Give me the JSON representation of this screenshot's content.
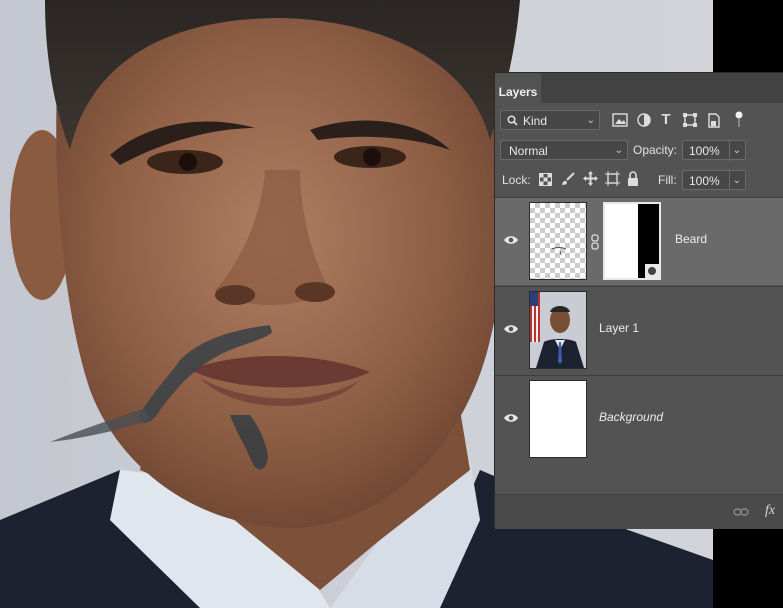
{
  "panel": {
    "tab_label": "Layers",
    "filter": {
      "selected": "Kind"
    },
    "blend": {
      "mode": "Normal",
      "opacity_label": "Opacity:",
      "opacity_value": "100%"
    },
    "lock": {
      "label": "Lock:",
      "fill_label": "Fill:",
      "fill_value": "100%"
    },
    "layers": [
      {
        "name": "Beard",
        "selected": true,
        "visible": true
      },
      {
        "name": "Layer 1",
        "selected": false,
        "visible": true
      },
      {
        "name": "Background",
        "selected": false,
        "visible": true
      }
    ],
    "footer": {
      "fx_label": "fx"
    }
  },
  "colors": {
    "panel_bg": "#535353",
    "selected_row": "#6a6a6a",
    "tab_bar": "#424242"
  }
}
